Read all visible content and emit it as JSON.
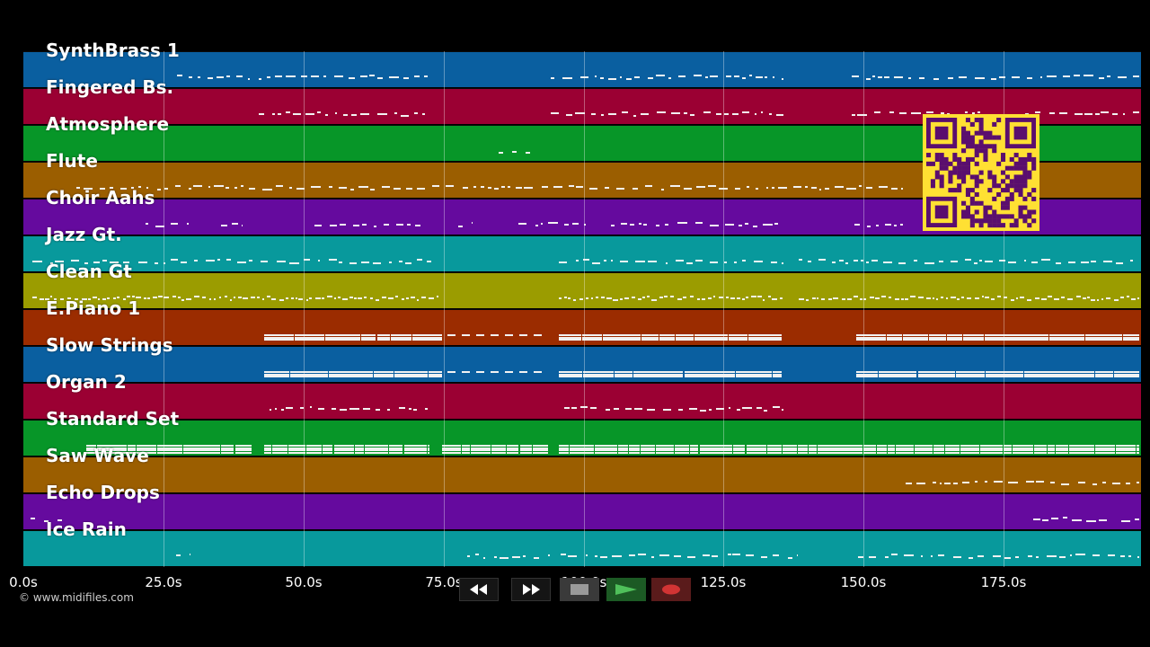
{
  "tracks": [
    {
      "name": "SynthBrass 1",
      "color": "#0a5fa0"
    },
    {
      "name": "Fingered Bs.",
      "color": "#9b0033"
    },
    {
      "name": "Atmosphere",
      "color": "#079628"
    },
    {
      "name": "Flute",
      "color": "#9b5e00"
    },
    {
      "name": "Choir Aahs",
      "color": "#650a9e"
    },
    {
      "name": "Jazz Gt.",
      "color": "#08999c"
    },
    {
      "name": "Clean Gt",
      "color": "#9b9c00"
    },
    {
      "name": "E.Piano 1",
      "color": "#9b2c00"
    },
    {
      "name": "Slow Strings",
      "color": "#0a5fa0"
    },
    {
      "name": "Organ 2",
      "color": "#9b0033"
    },
    {
      "name": "Standard Set",
      "color": "#079628"
    },
    {
      "name": "Saw Wave",
      "color": "#9b5e00"
    },
    {
      "name": "Echo Drops",
      "color": "#650a9e"
    },
    {
      "name": "Ice Rain",
      "color": "#08999c"
    }
  ],
  "timeline": {
    "ticks": [
      "0.0s",
      "25.0s",
      "50.0s",
      "75.0s",
      "100.0s",
      "125.0s",
      "150.0s",
      "175.0s"
    ],
    "tick_values": [
      0,
      25,
      50,
      75,
      100,
      125,
      150,
      175
    ],
    "max_seconds": 199.5
  },
  "copyright": "© www.midifiles.com",
  "transport": {
    "buttons": [
      {
        "name": "rewind-button",
        "icon": "rewind-icon"
      },
      {
        "name": "fast-forward-button",
        "icon": "fast-forward-icon"
      },
      {
        "name": "stop-button",
        "icon": "stop-icon"
      },
      {
        "name": "play-button",
        "icon": "play-icon"
      },
      {
        "name": "record-button",
        "icon": "record-icon"
      }
    ]
  },
  "qr_code": {
    "icon": "qr-code-icon",
    "color": "#ffe033",
    "fg": "#5a0e6e"
  }
}
